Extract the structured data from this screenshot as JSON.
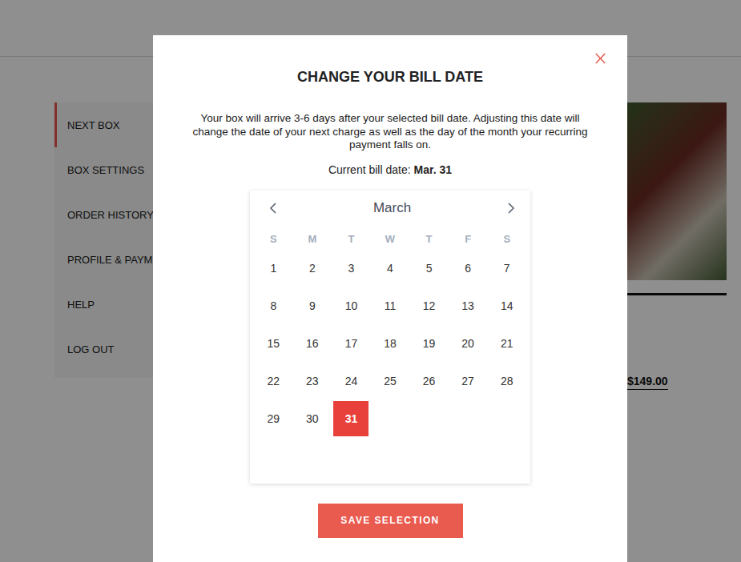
{
  "page": {
    "sidebar": {
      "items": [
        {
          "label": "NEXT BOX",
          "selected": true
        },
        {
          "label": "BOX SETTINGS",
          "selected": false
        },
        {
          "label": "ORDER HISTORY",
          "selected": false
        },
        {
          "label": "PROFILE & PAYM",
          "selected": false
        },
        {
          "label": "HELP",
          "selected": false
        },
        {
          "label": "LOG OUT",
          "selected": false
        }
      ]
    },
    "price": "$149.00"
  },
  "modal": {
    "title": "CHANGE YOUR BILL DATE",
    "description": "Your box will arrive 3-6 days after your selected bill date. Adjusting this date will change the date of your next charge as well as the day of the month your recurring payment falls on.",
    "current_bill_date": {
      "label": "Current bill date:",
      "value": "Mar. 31"
    },
    "calendar": {
      "month": "March",
      "weekdays": [
        "S",
        "M",
        "T",
        "W",
        "T",
        "F",
        "S"
      ],
      "weeks": [
        [
          {
            "label": "1",
            "selected": false
          },
          {
            "label": "2",
            "selected": false
          },
          {
            "label": "3",
            "selected": false
          },
          {
            "label": "4",
            "selected": false
          },
          {
            "label": "5",
            "selected": false
          },
          {
            "label": "6",
            "selected": false
          },
          {
            "label": "7",
            "selected": false
          }
        ],
        [
          {
            "label": "8",
            "selected": false
          },
          {
            "label": "9",
            "selected": false
          },
          {
            "label": "10",
            "selected": false
          },
          {
            "label": "11",
            "selected": false
          },
          {
            "label": "12",
            "selected": false
          },
          {
            "label": "13",
            "selected": false
          },
          {
            "label": "14",
            "selected": false
          }
        ],
        [
          {
            "label": "15",
            "selected": false
          },
          {
            "label": "16",
            "selected": false
          },
          {
            "label": "17",
            "selected": false
          },
          {
            "label": "18",
            "selected": false
          },
          {
            "label": "19",
            "selected": false
          },
          {
            "label": "20",
            "selected": false
          },
          {
            "label": "21",
            "selected": false
          }
        ],
        [
          {
            "label": "22",
            "selected": false
          },
          {
            "label": "23",
            "selected": false
          },
          {
            "label": "24",
            "selected": false
          },
          {
            "label": "25",
            "selected": false
          },
          {
            "label": "26",
            "selected": false
          },
          {
            "label": "27",
            "selected": false
          },
          {
            "label": "28",
            "selected": false
          }
        ],
        [
          {
            "label": "29",
            "selected": false
          },
          {
            "label": "30",
            "selected": false
          },
          {
            "label": "31",
            "selected": true
          }
        ]
      ]
    },
    "button": "SAVE SELECTION"
  }
}
